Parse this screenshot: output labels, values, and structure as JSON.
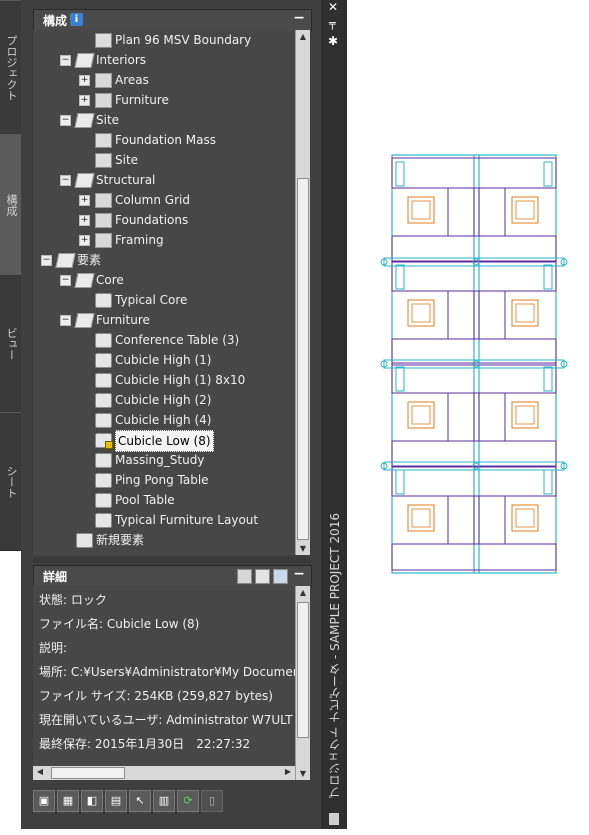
{
  "left_tabs": [
    {
      "label": "プロジェクト",
      "active": false
    },
    {
      "label": "構成",
      "active": true
    },
    {
      "label": "ビュー",
      "active": false
    },
    {
      "label": "シート",
      "active": false
    }
  ],
  "constructs_panel": {
    "title": "構成",
    "info_icon": "info-icon",
    "collapse": "−"
  },
  "tree": [
    {
      "label": "Plan 96 MSV Boundary",
      "level": 3,
      "icon": "building",
      "expander": ""
    },
    {
      "label": "Interiors",
      "level": 2,
      "icon": "folder-open",
      "expander": "−"
    },
    {
      "label": "Areas",
      "level": 3,
      "icon": "folder",
      "expander": "+"
    },
    {
      "label": "Furniture",
      "level": 3,
      "icon": "folder",
      "expander": "+"
    },
    {
      "label": "Site",
      "level": 2,
      "icon": "folder-open",
      "expander": "−"
    },
    {
      "label": "Foundation Mass",
      "level": 3,
      "icon": "building",
      "expander": ""
    },
    {
      "label": "Site",
      "level": 3,
      "icon": "building",
      "expander": ""
    },
    {
      "label": "Structural",
      "level": 2,
      "icon": "folder-open",
      "expander": "−"
    },
    {
      "label": "Column Grid",
      "level": 3,
      "icon": "folder",
      "expander": "+"
    },
    {
      "label": "Foundations",
      "level": 3,
      "icon": "folder",
      "expander": "+"
    },
    {
      "label": "Framing",
      "level": 3,
      "icon": "folder",
      "expander": "+"
    },
    {
      "label": "要素",
      "level": 1,
      "icon": "folder-open",
      "expander": "−"
    },
    {
      "label": "Core",
      "level": 2,
      "icon": "folder-open",
      "expander": "−"
    },
    {
      "label": "Typical Core",
      "level": 3,
      "icon": "element",
      "expander": ""
    },
    {
      "label": "Furniture",
      "level": 2,
      "icon": "folder-open",
      "expander": "−"
    },
    {
      "label": "Conference Table (3)",
      "level": 3,
      "icon": "element",
      "expander": ""
    },
    {
      "label": "Cubicle High (1)",
      "level": 3,
      "icon": "element",
      "expander": ""
    },
    {
      "label": "Cubicle High (1) 8x10",
      "level": 3,
      "icon": "element",
      "expander": ""
    },
    {
      "label": "Cubicle High (2)",
      "level": 3,
      "icon": "element",
      "expander": ""
    },
    {
      "label": "Cubicle High (4)",
      "level": 3,
      "icon": "element",
      "expander": ""
    },
    {
      "label": "Cubicle Low (8)",
      "level": 3,
      "icon": "element-locked",
      "expander": "",
      "selected": true
    },
    {
      "label": "Massing_Study",
      "level": 3,
      "icon": "element",
      "expander": ""
    },
    {
      "label": "Ping Pong Table",
      "level": 3,
      "icon": "element",
      "expander": ""
    },
    {
      "label": "Pool Table",
      "level": 3,
      "icon": "element",
      "expander": ""
    },
    {
      "label": "Typical Furniture Layout",
      "level": 3,
      "icon": "element",
      "expander": ""
    },
    {
      "label": "新規要素",
      "level": 2,
      "icon": "element",
      "expander": ""
    }
  ],
  "details_panel": {
    "title": "詳細",
    "rows": [
      "状態: ロック",
      "ファイル名: Cubicle Low (8)",
      "説明:",
      "場所: C:¥Users¥Administrator¥My Documen",
      "ファイル サイズ: 254KB (259,827 bytes)",
      "現在開いているユーザ: Administrator W7ULT",
      "最終保存: 2015年1月30日　22:27:32"
    ]
  },
  "side_bar": {
    "title": "プロジェクト ナビゲータ - SAMPLE PROJECT 2016",
    "close": "✕"
  },
  "toolbar_icons": [
    "add-construct-icon",
    "add-building-icon",
    "add-element-icon",
    "paste-icon",
    "select-icon",
    "properties-icon",
    "refresh-icon",
    "repath-icon"
  ],
  "colors": {
    "cyan": "#2bb6c7",
    "purple": "#5b2d9e",
    "orange": "#e07b1a"
  }
}
